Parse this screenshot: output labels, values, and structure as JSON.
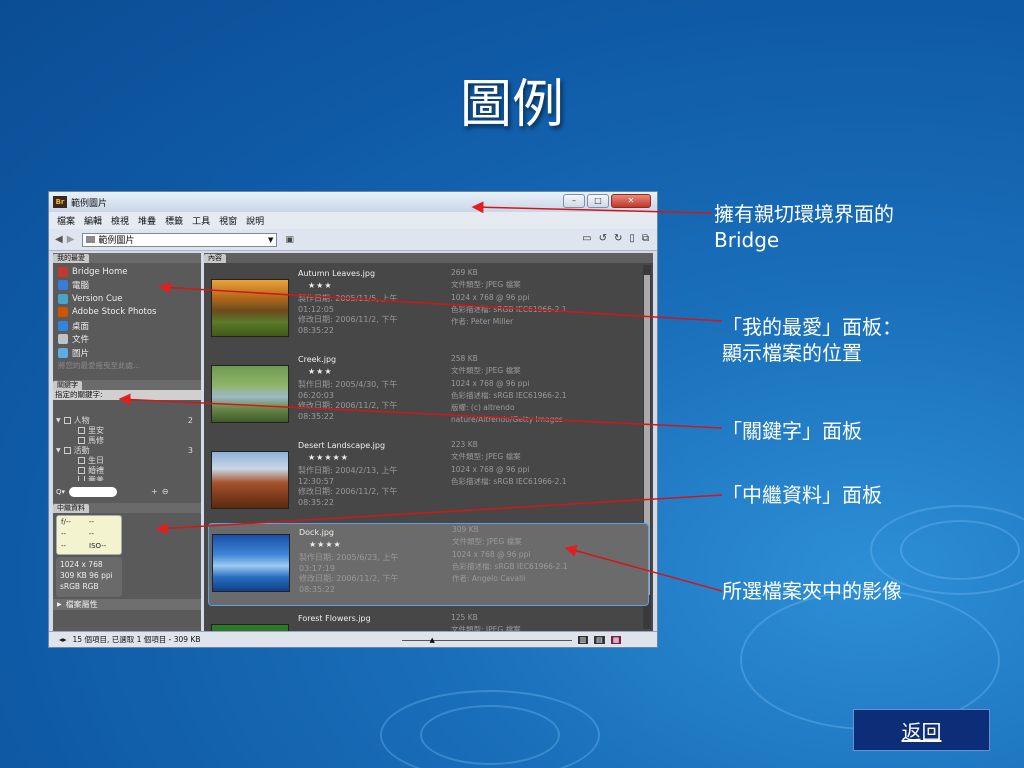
{
  "slide": {
    "title": "圖例",
    "back_label": "返回"
  },
  "annotations": [
    {
      "lines": [
        "擁有親切環境界面的",
        "Bridge"
      ]
    },
    {
      "lines": [
        "「我的最愛」面板：",
        "顯示檔案的位置"
      ]
    },
    {
      "lines": [
        "「關鍵字」面板"
      ]
    },
    {
      "lines": [
        "「中繼資料」面板"
      ]
    },
    {
      "lines": [
        "所選檔案夾中的影像"
      ]
    }
  ],
  "window": {
    "title": "範例圖片",
    "logo": "Br",
    "menus": [
      "檔案",
      "編輯",
      "檢視",
      "堆疊",
      "標籤",
      "工具",
      "視窗",
      "說明"
    ],
    "path": "範例圖片",
    "favorites_tab": "我的最愛",
    "favorites": [
      {
        "label": "Bridge Home",
        "icon": "bridge-home-icon"
      },
      {
        "label": "電腦",
        "icon": "computer-icon"
      },
      {
        "label": "Version Cue",
        "icon": "version-cue-icon"
      },
      {
        "label": "Adobe Stock Photos",
        "icon": "stock-photos-icon"
      },
      {
        "label": "桌面",
        "icon": "desktop-icon"
      },
      {
        "label": "文件",
        "icon": "documents-icon"
      },
      {
        "label": "圖片",
        "icon": "pictures-icon"
      }
    ],
    "favorites_hint": "將您的最愛拖曳至此處...",
    "keywords_tab": "關鍵字",
    "keywords_assigned": "指定的關鍵字:",
    "keyword_groups": [
      {
        "name": "人物",
        "count": "2",
        "items": [
          "里安",
          "馬修"
        ]
      },
      {
        "name": "活動",
        "count": "3",
        "items": [
          "生日",
          "婚禮",
          "畢業"
        ]
      }
    ],
    "metadata_tab": "中繼資料",
    "metadata_camera": [
      "f/--",
      "--",
      "--",
      "--",
      "--",
      "ISO--"
    ],
    "metadata_info": [
      "1024 x 768",
      "309 KB 96 ppi",
      "sRGB   RGB"
    ],
    "file_props": "檔案屬性",
    "content_tab": "內容",
    "files": [
      {
        "name": "Autumn Leaves.jpg",
        "stars": "★★★",
        "created_label": "製作日期: 2005/11/5, 上午",
        "created_time": "01:12:05",
        "modified_label": "修改日期: 2006/11/2, 下午",
        "modified_time": "08:35:22",
        "size": "269 KB",
        "type": "文件類型: JPEG 檔案",
        "dims": "1024 x 768 @ 96 ppi",
        "color": "色彩描述檔: sRGB IEC61966-2.1",
        "extra": "作者: Peter Miller",
        "extra2": ""
      },
      {
        "name": "Creek.jpg",
        "stars": "★★★",
        "created_label": "製作日期: 2005/4/30, 下午",
        "created_time": "06:20:03",
        "modified_label": "修改日期: 2006/11/2, 下午",
        "modified_time": "08:35:22",
        "size": "258 KB",
        "type": "文件類型: JPEG 檔案",
        "dims": "1024 x 768 @ 96 ppi",
        "color": "色彩描述檔: sRGB IEC61966-2.1",
        "extra": "版權: (c) altrendo",
        "extra2": "nature/Altrendo/Getty Images"
      },
      {
        "name": "Desert Landscape.jpg",
        "stars": "★★★★★",
        "created_label": "製作日期: 2004/2/13, 上午",
        "created_time": "12:30:57",
        "modified_label": "修改日期: 2006/11/2, 下午",
        "modified_time": "08:35:22",
        "size": "223 KB",
        "type": "文件類型: JPEG 檔案",
        "dims": "1024 x 768 @ 96 ppi",
        "color": "色彩描述檔: sRGB IEC61966-2.1",
        "extra": "",
        "extra2": ""
      },
      {
        "name": "Dock.jpg",
        "stars": "★★★★",
        "created_label": "製作日期: 2005/6/23, 上午",
        "created_time": "03:17:19",
        "modified_label": "修改日期: 2006/11/2, 下午",
        "modified_time": "08:35:22",
        "size": "309 KB",
        "type": "文件類型: JPEG 檔案",
        "dims": "1024 x 768 @ 96 ppi",
        "color": "色彩描述檔: sRGB IEC61966-2.1",
        "extra": "作者: Angelo Cavalli",
        "extra2": ""
      },
      {
        "name": "Forest Flowers.jpg",
        "stars": "",
        "created_label": "",
        "created_time": "",
        "modified_label": "",
        "modified_time": "",
        "size": "125 KB",
        "type": "文件類型: JPEG 檔案",
        "dims": "",
        "color": "",
        "extra": "",
        "extra2": ""
      }
    ],
    "status_text": "15 個項目, 已選取 1 個項目 - 309 KB"
  }
}
